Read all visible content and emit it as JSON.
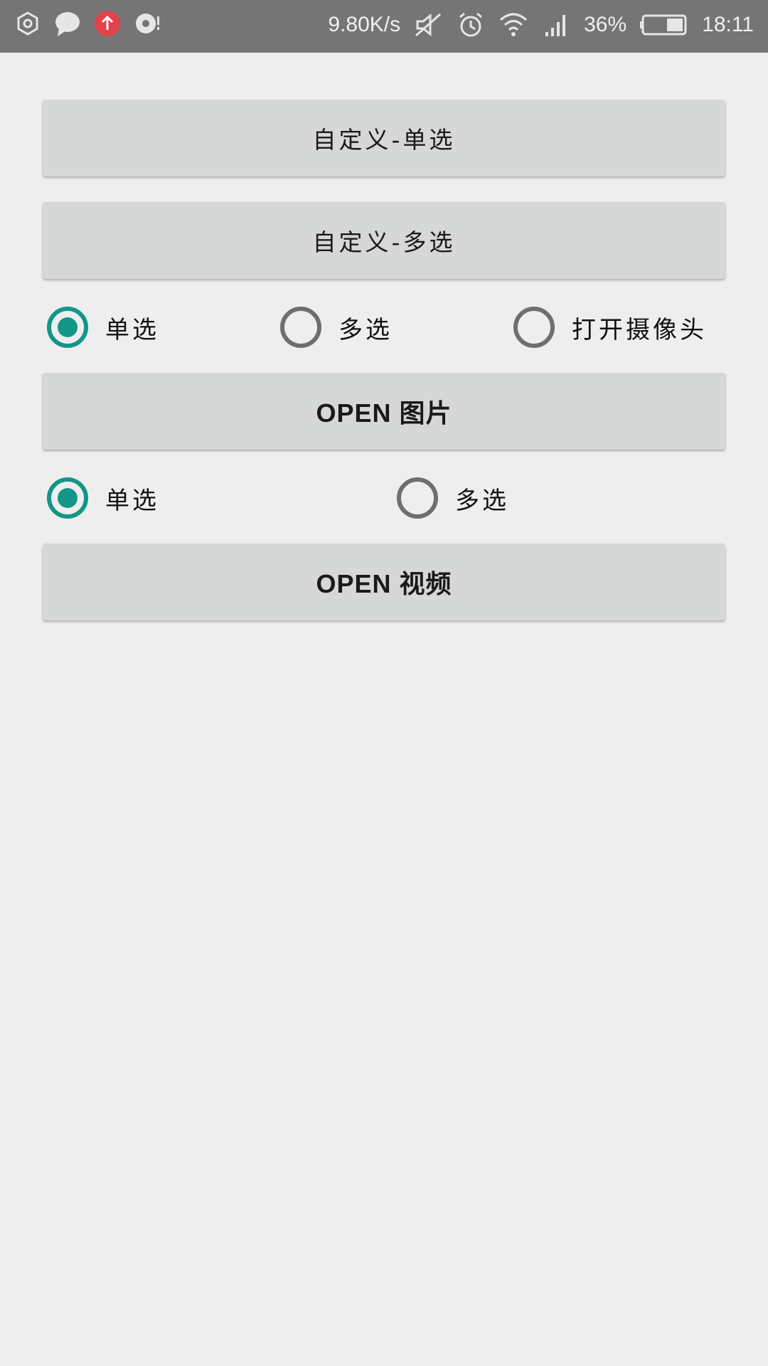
{
  "status_bar": {
    "network_speed": "9.80K/s",
    "battery_percent": "36%",
    "time": "18:11",
    "icons": [
      "hexagon-icon",
      "chat-bubble-icon",
      "upload-icon",
      "media-icon",
      "mute-icon",
      "alarm-icon",
      "wifi-icon",
      "signal-icon",
      "battery-icon"
    ],
    "upload_color": "#e2424a"
  },
  "buttons": {
    "custom_single": "自定义-单选",
    "custom_multi": "自定义-多选",
    "open_image": "OPEN 图片",
    "open_video": "OPEN 视频"
  },
  "image_mode": {
    "options": [
      "单选",
      "多选",
      "打开摄像头"
    ],
    "selected": "单选"
  },
  "video_mode": {
    "options": [
      "单选",
      "多选"
    ],
    "selected": "单选"
  },
  "colors": {
    "accent": "#129688",
    "background": "#eeeeee",
    "button": "#d6d7d7"
  }
}
